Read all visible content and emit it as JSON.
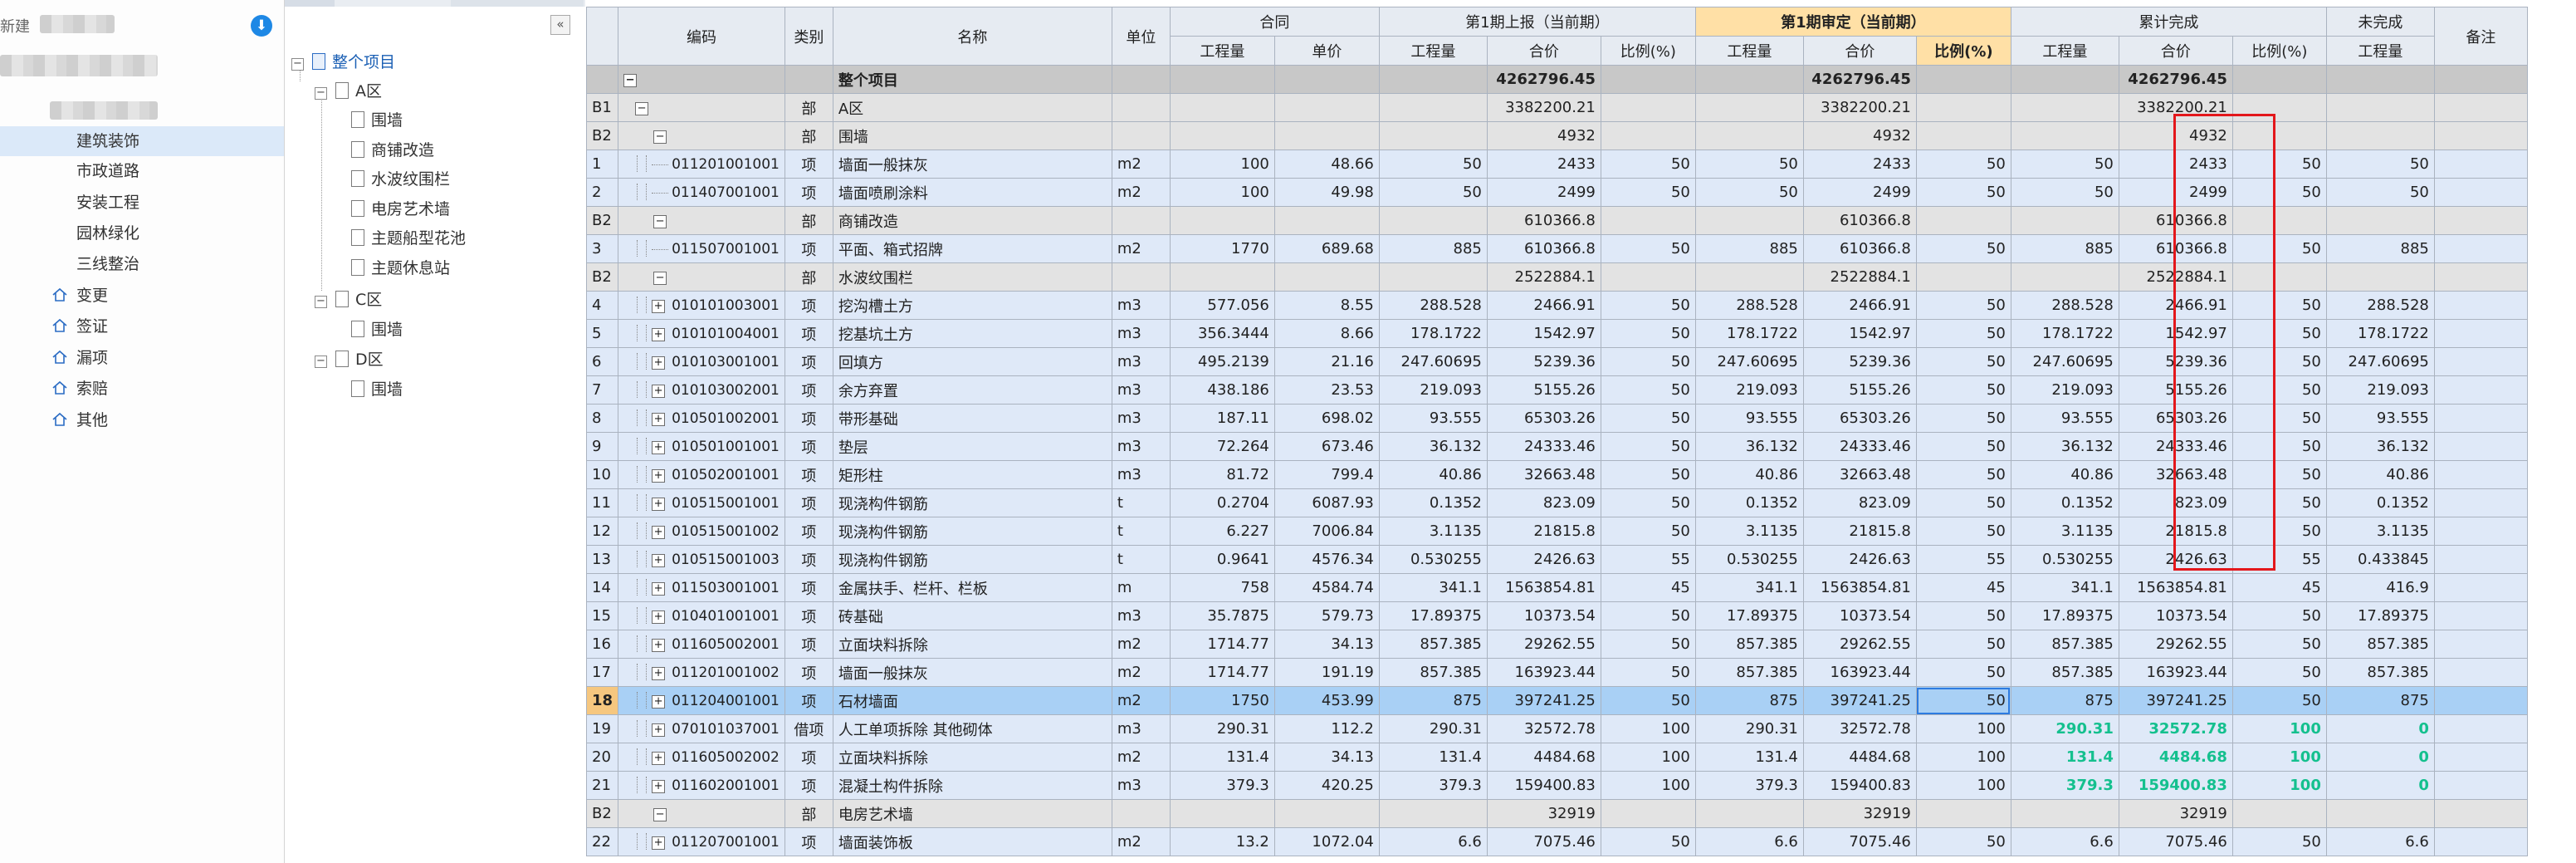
{
  "nav": {
    "title": "新建",
    "items": [
      {
        "label": "建筑装饰",
        "active": true
      },
      {
        "label": "市政道路"
      },
      {
        "label": "安装工程"
      },
      {
        "label": "园林绿化"
      },
      {
        "label": "三线整治"
      }
    ],
    "groups": [
      "变更",
      "签证",
      "漏项",
      "索赔",
      "其他"
    ]
  },
  "tree": {
    "root": "整个项目",
    "areas": [
      {
        "label": "A区",
        "children": [
          "围墙",
          "商铺改造",
          "水波纹围栏",
          "电房艺术墙",
          "主题船型花池",
          "主题休息站"
        ]
      },
      {
        "label": "C区",
        "children": [
          "围墙"
        ]
      },
      {
        "label": "D区",
        "children": [
          "围墙"
        ]
      }
    ],
    "collapse_glyph": "«"
  },
  "grid": {
    "headers": {
      "code": "编码",
      "type": "类别",
      "name": "名称",
      "unit": "单位",
      "remark": "备注",
      "contract": "合同",
      "report": "第1期上报（当前期）",
      "audit": "第1期审定（当前期）",
      "cumulative": "累计完成",
      "unfinished": "未完成",
      "qty": "工程量",
      "price": "单价",
      "total": "合价",
      "ratio": "比例(%)"
    },
    "rows": [
      {
        "kind": "total",
        "name": "整个项目",
        "r_total": "4262796.45",
        "a_total": "4262796.45",
        "c_total": "4262796.45"
      },
      {
        "kind": "group",
        "rn": "B1",
        "type": "部",
        "name": "A区",
        "level": 1,
        "r_total": "3382200.21",
        "a_total": "3382200.21",
        "c_total": "3382200.21"
      },
      {
        "kind": "group",
        "rn": "B2",
        "type": "部",
        "name": "围墙",
        "level": 2,
        "r_total": "4932",
        "a_total": "4932",
        "c_total": "4932"
      },
      {
        "kind": "item",
        "rn": "1",
        "code": "011201001001",
        "type": "项",
        "name": "墙面一般抹灰",
        "unit": "m2",
        "qty": "100",
        "price": "48.66",
        "r_qty": "50",
        "r_total": "2433",
        "r_ratio": "50",
        "a_qty": "50",
        "a_total": "2433",
        "a_ratio": "50",
        "c_qty": "50",
        "c_total": "2433",
        "c_ratio": "50",
        "u_qty": "50"
      },
      {
        "kind": "item",
        "rn": "2",
        "code": "011407001001",
        "type": "项",
        "name": "墙面喷刷涂料",
        "unit": "m2",
        "qty": "100",
        "price": "49.98",
        "r_qty": "50",
        "r_total": "2499",
        "r_ratio": "50",
        "a_qty": "50",
        "a_total": "2499",
        "a_ratio": "50",
        "c_qty": "50",
        "c_total": "2499",
        "c_ratio": "50",
        "u_qty": "50"
      },
      {
        "kind": "group",
        "rn": "B2",
        "type": "部",
        "name": "商铺改造",
        "level": 2,
        "r_total": "610366.8",
        "a_total": "610366.8",
        "c_total": "610366.8"
      },
      {
        "kind": "item",
        "rn": "3",
        "code": "011507001001",
        "type": "项",
        "name": "平面、箱式招牌",
        "unit": "m2",
        "qty": "1770",
        "price": "689.68",
        "r_qty": "885",
        "r_total": "610366.8",
        "r_ratio": "50",
        "a_qty": "885",
        "a_total": "610366.8",
        "a_ratio": "50",
        "c_qty": "885",
        "c_total": "610366.8",
        "c_ratio": "50",
        "u_qty": "885"
      },
      {
        "kind": "group",
        "rn": "B2",
        "type": "部",
        "name": "水波纹围栏",
        "level": 2,
        "r_total": "2522884.1",
        "a_total": "2522884.1",
        "c_total": "2522884.1"
      },
      {
        "kind": "item",
        "rn": "4",
        "code": "010101003001",
        "type": "项",
        "name": "挖沟槽土方",
        "unit": "m3",
        "plus": true,
        "qty": "577.056",
        "price": "8.55",
        "r_qty": "288.528",
        "r_total": "2466.91",
        "r_ratio": "50",
        "a_qty": "288.528",
        "a_total": "2466.91",
        "a_ratio": "50",
        "c_qty": "288.528",
        "c_total": "2466.91",
        "c_ratio": "50",
        "u_qty": "288.528"
      },
      {
        "kind": "item",
        "rn": "5",
        "code": "010101004001",
        "type": "项",
        "name": "挖基坑土方",
        "unit": "m3",
        "plus": true,
        "qty": "356.3444",
        "price": "8.66",
        "r_qty": "178.1722",
        "r_total": "1542.97",
        "r_ratio": "50",
        "a_qty": "178.1722",
        "a_total": "1542.97",
        "a_ratio": "50",
        "c_qty": "178.1722",
        "c_total": "1542.97",
        "c_ratio": "50",
        "u_qty": "178.1722"
      },
      {
        "kind": "item",
        "rn": "6",
        "code": "010103001001",
        "type": "项",
        "name": "回填方",
        "unit": "m3",
        "plus": true,
        "qty": "495.2139",
        "price": "21.16",
        "r_qty": "247.60695",
        "r_total": "5239.36",
        "r_ratio": "50",
        "a_qty": "247.60695",
        "a_total": "5239.36",
        "a_ratio": "50",
        "c_qty": "247.60695",
        "c_total": "5239.36",
        "c_ratio": "50",
        "u_qty": "247.60695"
      },
      {
        "kind": "item",
        "rn": "7",
        "code": "010103002001",
        "type": "项",
        "name": "余方弃置",
        "unit": "m3",
        "plus": true,
        "qty": "438.186",
        "price": "23.53",
        "r_qty": "219.093",
        "r_total": "5155.26",
        "r_ratio": "50",
        "a_qty": "219.093",
        "a_total": "5155.26",
        "a_ratio": "50",
        "c_qty": "219.093",
        "c_total": "5155.26",
        "c_ratio": "50",
        "u_qty": "219.093"
      },
      {
        "kind": "item",
        "rn": "8",
        "code": "010501002001",
        "type": "项",
        "name": "带形基础",
        "unit": "m3",
        "plus": true,
        "qty": "187.11",
        "price": "698.02",
        "r_qty": "93.555",
        "r_total": "65303.26",
        "r_ratio": "50",
        "a_qty": "93.555",
        "a_total": "65303.26",
        "a_ratio": "50",
        "c_qty": "93.555",
        "c_total": "65303.26",
        "c_ratio": "50",
        "u_qty": "93.555"
      },
      {
        "kind": "item",
        "rn": "9",
        "code": "010501001001",
        "type": "项",
        "name": "垫层",
        "unit": "m3",
        "plus": true,
        "qty": "72.264",
        "price": "673.46",
        "r_qty": "36.132",
        "r_total": "24333.46",
        "r_ratio": "50",
        "a_qty": "36.132",
        "a_total": "24333.46",
        "a_ratio": "50",
        "c_qty": "36.132",
        "c_total": "24333.46",
        "c_ratio": "50",
        "u_qty": "36.132"
      },
      {
        "kind": "item",
        "rn": "10",
        "code": "010502001001",
        "type": "项",
        "name": "矩形柱",
        "unit": "m3",
        "plus": true,
        "qty": "81.72",
        "price": "799.4",
        "r_qty": "40.86",
        "r_total": "32663.48",
        "r_ratio": "50",
        "a_qty": "40.86",
        "a_total": "32663.48",
        "a_ratio": "50",
        "c_qty": "40.86",
        "c_total": "32663.48",
        "c_ratio": "50",
        "u_qty": "40.86"
      },
      {
        "kind": "item",
        "rn": "11",
        "code": "010515001001",
        "type": "项",
        "name": "现浇构件钢筋",
        "unit": "t",
        "plus": true,
        "qty": "0.2704",
        "price": "6087.93",
        "r_qty": "0.1352",
        "r_total": "823.09",
        "r_ratio": "50",
        "a_qty": "0.1352",
        "a_total": "823.09",
        "a_ratio": "50",
        "c_qty": "0.1352",
        "c_total": "823.09",
        "c_ratio": "50",
        "u_qty": "0.1352"
      },
      {
        "kind": "item",
        "rn": "12",
        "code": "010515001002",
        "type": "项",
        "name": "现浇构件钢筋",
        "unit": "t",
        "plus": true,
        "qty": "6.227",
        "price": "7006.84",
        "r_qty": "3.1135",
        "r_total": "21815.8",
        "r_ratio": "50",
        "a_qty": "3.1135",
        "a_total": "21815.8",
        "a_ratio": "50",
        "c_qty": "3.1135",
        "c_total": "21815.8",
        "c_ratio": "50",
        "u_qty": "3.1135"
      },
      {
        "kind": "item",
        "rn": "13",
        "code": "010515001003",
        "type": "项",
        "name": "现浇构件钢筋",
        "unit": "t",
        "plus": true,
        "qty": "0.9641",
        "price": "4576.34",
        "r_qty": "0.530255",
        "r_total": "2426.63",
        "r_ratio": "55",
        "a_qty": "0.530255",
        "a_total": "2426.63",
        "a_ratio": "55",
        "c_qty": "0.530255",
        "c_total": "2426.63",
        "c_ratio": "55",
        "u_qty": "0.433845"
      },
      {
        "kind": "item",
        "rn": "14",
        "code": "011503001001",
        "type": "项",
        "name": "金属扶手、栏杆、栏板",
        "unit": "m",
        "plus": true,
        "qty": "758",
        "price": "4584.74",
        "r_qty": "341.1",
        "r_total": "1563854.81",
        "r_ratio": "45",
        "a_qty": "341.1",
        "a_total": "1563854.81",
        "a_ratio": "45",
        "c_qty": "341.1",
        "c_total": "1563854.81",
        "c_ratio": "45",
        "u_qty": "416.9"
      },
      {
        "kind": "item",
        "rn": "15",
        "code": "010401001001",
        "type": "项",
        "name": "砖基础",
        "unit": "m3",
        "plus": true,
        "qty": "35.7875",
        "price": "579.73",
        "r_qty": "17.89375",
        "r_total": "10373.54",
        "r_ratio": "50",
        "a_qty": "17.89375",
        "a_total": "10373.54",
        "a_ratio": "50",
        "c_qty": "17.89375",
        "c_total": "10373.54",
        "c_ratio": "50",
        "u_qty": "17.89375"
      },
      {
        "kind": "item",
        "rn": "16",
        "code": "011605002001",
        "type": "项",
        "name": "立面块料拆除",
        "unit": "m2",
        "plus": true,
        "qty": "1714.77",
        "price": "34.13",
        "r_qty": "857.385",
        "r_total": "29262.55",
        "r_ratio": "50",
        "a_qty": "857.385",
        "a_total": "29262.55",
        "a_ratio": "50",
        "c_qty": "857.385",
        "c_total": "29262.55",
        "c_ratio": "50",
        "u_qty": "857.385"
      },
      {
        "kind": "item",
        "rn": "17",
        "code": "011201001002",
        "type": "项",
        "name": "墙面一般抹灰",
        "unit": "m2",
        "plus": true,
        "qty": "1714.77",
        "price": "191.19",
        "r_qty": "857.385",
        "r_total": "163923.44",
        "r_ratio": "50",
        "a_qty": "857.385",
        "a_total": "163923.44",
        "a_ratio": "50",
        "c_qty": "857.385",
        "c_total": "163923.44",
        "c_ratio": "50",
        "u_qty": "857.385"
      },
      {
        "kind": "sel",
        "rn": "18",
        "code": "011204001001",
        "type": "项",
        "name": "石材墙面",
        "unit": "m2",
        "plus": true,
        "qty": "1750",
        "price": "453.99",
        "r_qty": "875",
        "r_total": "397241.25",
        "r_ratio": "50",
        "a_qty": "875",
        "a_total": "397241.25",
        "a_ratio": "50",
        "c_qty": "875",
        "c_total": "397241.25",
        "c_ratio": "50",
        "u_qty": "875"
      },
      {
        "kind": "item",
        "rn": "19",
        "code": "070101037001",
        "type": "借项",
        "name": "人工单项拆除 其他砌体",
        "unit": "m3",
        "plus": true,
        "qty": "290.31",
        "price": "112.2",
        "r_qty": "290.31",
        "r_total": "32572.78",
        "r_ratio": "100",
        "a_qty": "290.31",
        "a_total": "32572.78",
        "a_ratio": "100",
        "c_qty": "290.31",
        "c_total": "32572.78",
        "c_ratio": "100",
        "u_qty": "0",
        "green": true
      },
      {
        "kind": "item",
        "rn": "20",
        "code": "011605002002",
        "type": "项",
        "name": "立面块料拆除",
        "unit": "m2",
        "plus": true,
        "qty": "131.4",
        "price": "34.13",
        "r_qty": "131.4",
        "r_total": "4484.68",
        "r_ratio": "100",
        "a_qty": "131.4",
        "a_total": "4484.68",
        "a_ratio": "100",
        "c_qty": "131.4",
        "c_total": "4484.68",
        "c_ratio": "100",
        "u_qty": "0",
        "green": true
      },
      {
        "kind": "item",
        "rn": "21",
        "code": "011602001001",
        "type": "项",
        "name": "混凝土构件拆除",
        "unit": "m3",
        "plus": true,
        "qty": "379.3",
        "price": "420.25",
        "r_qty": "379.3",
        "r_total": "159400.83",
        "r_ratio": "100",
        "a_qty": "379.3",
        "a_total": "159400.83",
        "a_ratio": "100",
        "c_qty": "379.3",
        "c_total": "159400.83",
        "c_ratio": "100",
        "u_qty": "0",
        "green": true
      },
      {
        "kind": "group",
        "rn": "B2",
        "type": "部",
        "name": "电房艺术墙",
        "level": 2,
        "r_total": "32919",
        "a_total": "32919",
        "c_total": "32919"
      },
      {
        "kind": "item",
        "rn": "22",
        "code": "011207001001",
        "type": "项",
        "name": "墙面装饰板",
        "unit": "m2",
        "plus": true,
        "qty": "13.2",
        "price": "1072.04",
        "r_qty": "6.6",
        "r_total": "7075.46",
        "r_ratio": "50",
        "a_qty": "6.6",
        "a_total": "7075.46",
        "a_ratio": "50",
        "c_qty": "6.6",
        "c_total": "7075.46",
        "c_ratio": "50",
        "u_qty": "6.6"
      }
    ]
  }
}
